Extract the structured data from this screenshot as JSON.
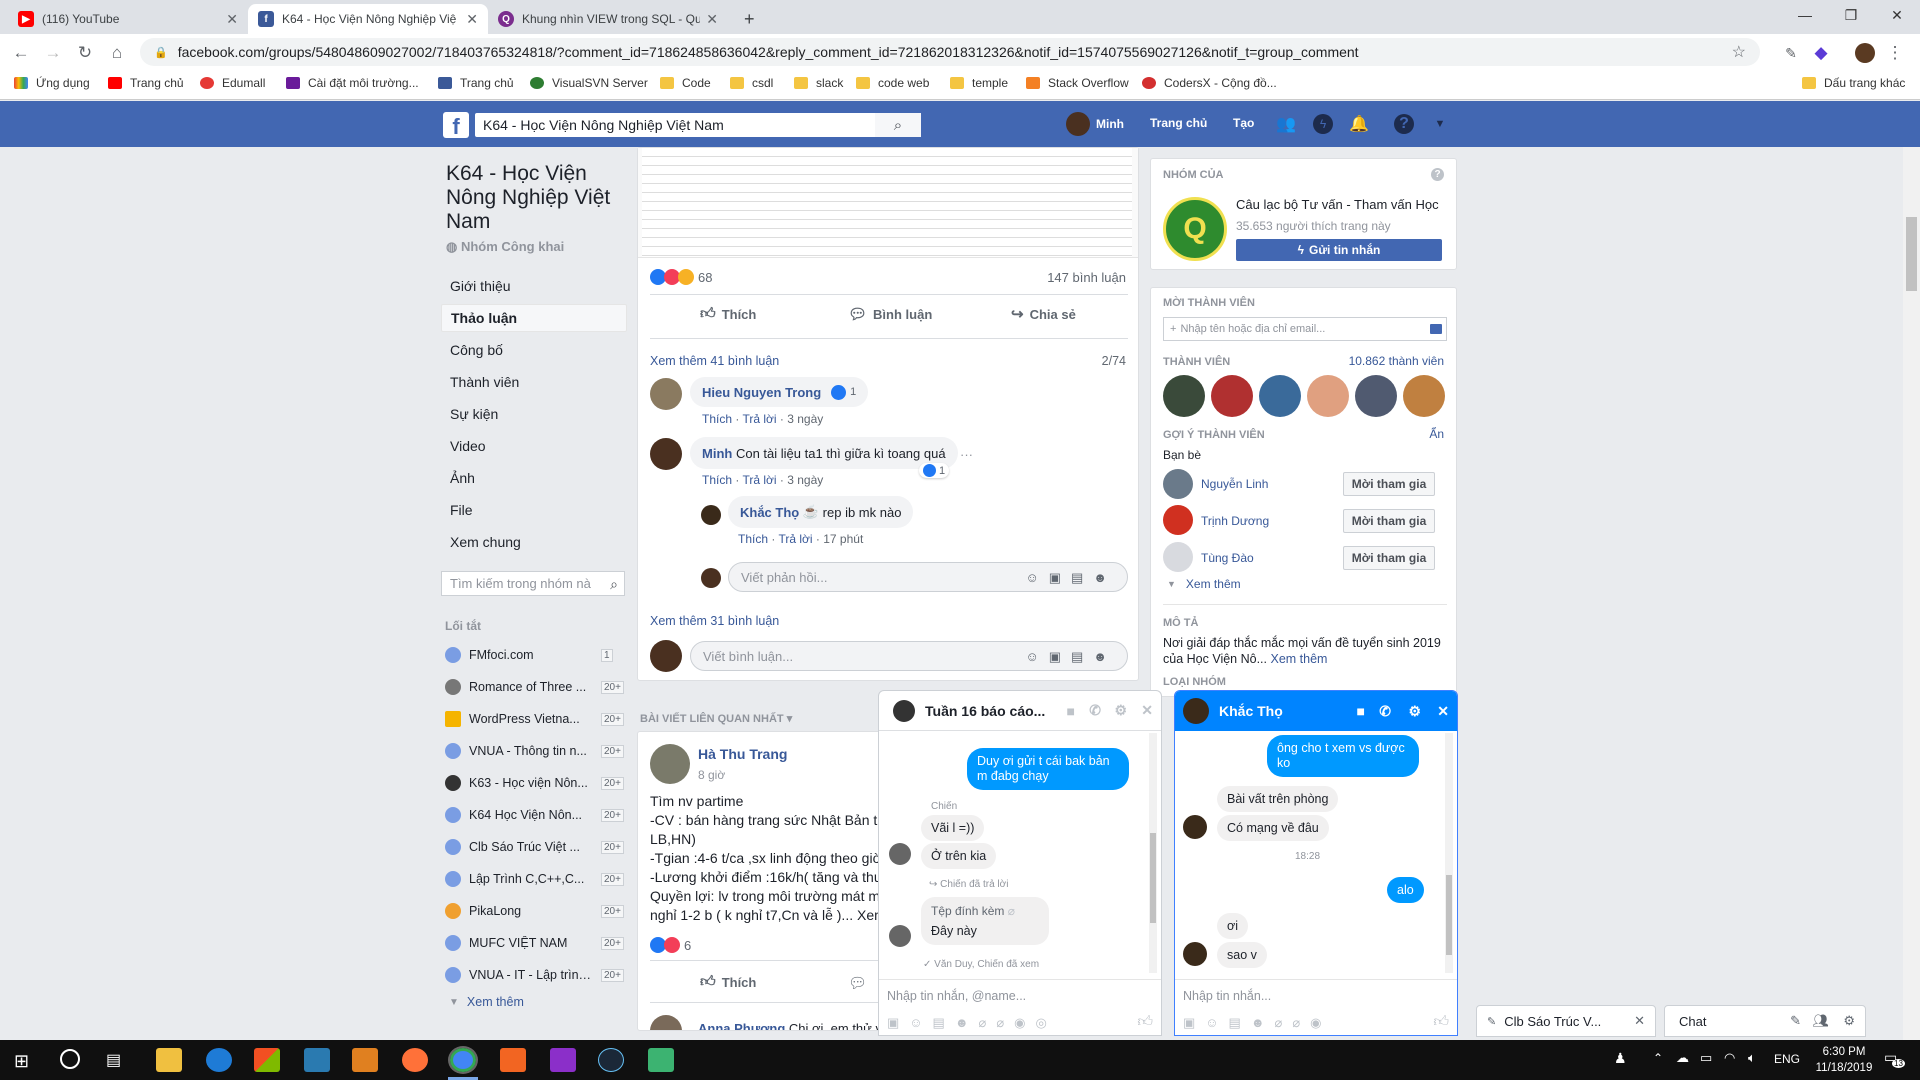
{
  "browser": {
    "tabs": [
      {
        "label": "(116) YouTube",
        "color": "#ff0000",
        "glyph": "▶"
      },
      {
        "label": "K64 - Học Viện Nông Nghiệp Việ",
        "color": "#3b5998",
        "glyph": "f"
      },
      {
        "label": "Khung nhìn VIEW trong SQL - Qu",
        "color": "#7b2d8e",
        "glyph": "Q"
      }
    ],
    "url": "facebook.com/groups/548048609027002/718403765324818/?comment_id=718624858636042&reply_comment_id=721862018312326&notif_id=1574075569027126&notif_t=group_comment",
    "bookmarks": [
      "Ứng dụng",
      "Trang chủ",
      "Edumall",
      "Cài đặt môi trường...",
      "Trang chủ",
      "VisualSVN Server",
      "Code",
      "csdl",
      "slack",
      "code web",
      "temple",
      "Stack Overflow",
      "CodersX - Cộng đồ..."
    ],
    "bookmarks_right": "Dấu trang khác"
  },
  "fb": {
    "search_value": "K64 - Học Viện Nông Nghiệp Việt Nam",
    "user": "Minh",
    "home": "Trang chủ",
    "create": "Tạo"
  },
  "group": {
    "title": "K64 - Học Viện Nông Nghiệp Việt Nam",
    "privacy": "Nhóm Công khai",
    "nav": [
      "Giới thiệu",
      "Thảo luận",
      "Công bố",
      "Thành viên",
      "Sự kiện",
      "Video",
      "Ảnh",
      "File",
      "Xem chung"
    ],
    "search_placeholder": "Tìm kiếm trong nhóm nà",
    "shortcuts_title": "Lối tắt",
    "shortcuts": [
      {
        "label": "FMfoci.com",
        "count": "1"
      },
      {
        "label": "Romance of Three ...",
        "count": "20+"
      },
      {
        "label": "WordPress Vietna...",
        "count": "20+"
      },
      {
        "label": "VNUA - Thông tin n...",
        "count": "20+"
      },
      {
        "label": "K63 - Học viện Nôn...",
        "count": "20+"
      },
      {
        "label": "K64 Học Viện Nôn...",
        "count": "20+"
      },
      {
        "label": "Clb Sáo Trúc Việt ...",
        "count": "20+"
      },
      {
        "label": "Lập Trình C,C++,C...",
        "count": "20+"
      },
      {
        "label": "PikaLong",
        "count": "20+"
      },
      {
        "label": "MUFC VIỆT NAM",
        "count": "20+"
      },
      {
        "label": "VNUA - IT - Lập trình C/...",
        "count": "20+"
      }
    ],
    "more": "Xem thêm"
  },
  "post": {
    "reactions": "68",
    "comments": "147 bình luận",
    "like": "Thích",
    "comment": "Bình luận",
    "share": "Chia sẻ",
    "more_comments": "Xem thêm 41 bình luận",
    "paging": "2/74",
    "c1": {
      "name": "Hieu Nguyen Trong",
      "likes": "1",
      "like": "Thích",
      "reply": "Trả lời",
      "time": "3 ngày"
    },
    "c2": {
      "name": "Minh",
      "text": "Con tài liệu ta1 thì giữa kì toang quá",
      "likes": "1",
      "like": "Thích",
      "reply": "Trả lời",
      "time": "3 ngày"
    },
    "c3": {
      "name": "Khắc Thọ",
      "text": "rep ib mk nào",
      "like": "Thích",
      "reply": "Trả lời",
      "time": "17 phút"
    },
    "reply_placeholder": "Viết phản hồi...",
    "more_comments2": "Xem thêm 31 bình luận",
    "comment_placeholder": "Viết bình luận..."
  },
  "related": {
    "title": "BÀI VIẾT LIÊN QUAN NHẤT",
    "author": "Hà Thu Trang",
    "time": "8 giờ",
    "lines": [
      "Tìm nv partime",
      "-CV : bán hàng trang sức Nhật Bản t",
      "LB,HN)",
      "-Tgian :4-6 t/ca ,sx linh động theo giờ",
      "-Lương khởi điểm :16k/h( tăng và thư",
      "Quyền lợi: lv trong môi trường mát m",
      "nghỉ 1-2 b ( k nghỉ t7,Cn và lễ )... Xem"
    ],
    "reactions": "6",
    "like": "Thích",
    "next_author": "Anna Phương",
    "next_text": "Chị ơi, em thử v"
  },
  "right": {
    "your_groups": "NHÓM CỦA",
    "page_name": "Câu lạc bộ Tư vấn - Tham vấn Học",
    "page_likes": "35.653 người thích trang này",
    "send_msg": "Gửi tin nhắn",
    "invite_title": "MỜI THÀNH VIÊN",
    "invite_placeholder": "Nhập tên hoặc địa chỉ email...",
    "members_title": "THÀNH VIÊN",
    "members_count": "10.862 thành viên",
    "suggest_title": "GỢI Ý THÀNH VIÊN",
    "hide": "Ẩn",
    "friends": "Bạn bè",
    "suggest": [
      {
        "name": "Nguyễn Linh",
        "btn": "Mời tham gia"
      },
      {
        "name": "Trịnh Dương",
        "btn": "Mời tham gia"
      },
      {
        "name": "Tùng Đào",
        "btn": "Mời tham gia"
      }
    ],
    "more": "Xem thêm",
    "desc_title": "MÔ TẢ",
    "desc": "Nơi giải đáp thắc mắc mọi vấn đề tuyển sinh 2019 của Học Viện Nô...",
    "desc_more": "Xem thêm",
    "type_title": "LOẠI NHÓM"
  },
  "chat1": {
    "title": "Tuần 16 báo cáo...",
    "me1": "Duy ơi gửi t cái bak bản m đabg chạy",
    "sender": "Chiến",
    "o1": "Vãi l =))",
    "o2": "Ở trên kia",
    "reply_note": "Chiến đã trả lời",
    "file": "Tệp đính kèm",
    "o3": "Đây này",
    "seen": "Văn Duy, Chiến đã xem",
    "placeholder": "Nhập tin nhắn, @name..."
  },
  "chat2": {
    "title": "Khắc Thọ",
    "me1": "ông cho t xem vs được ko",
    "o1": "Bài vất trên phòng",
    "o2": "Có mạng về đâu",
    "time": "18:28",
    "me2": "alo",
    "o3": "ơi",
    "o4": "sao v",
    "placeholder": "Nhập tin nhắn..."
  },
  "dock": {
    "minimized": "Clb Sáo Trúc V...",
    "chat": "Chat"
  },
  "taskbar": {
    "lang": "ENG",
    "time": "6:30 PM",
    "date": "11/18/2019",
    "notif": "13"
  }
}
